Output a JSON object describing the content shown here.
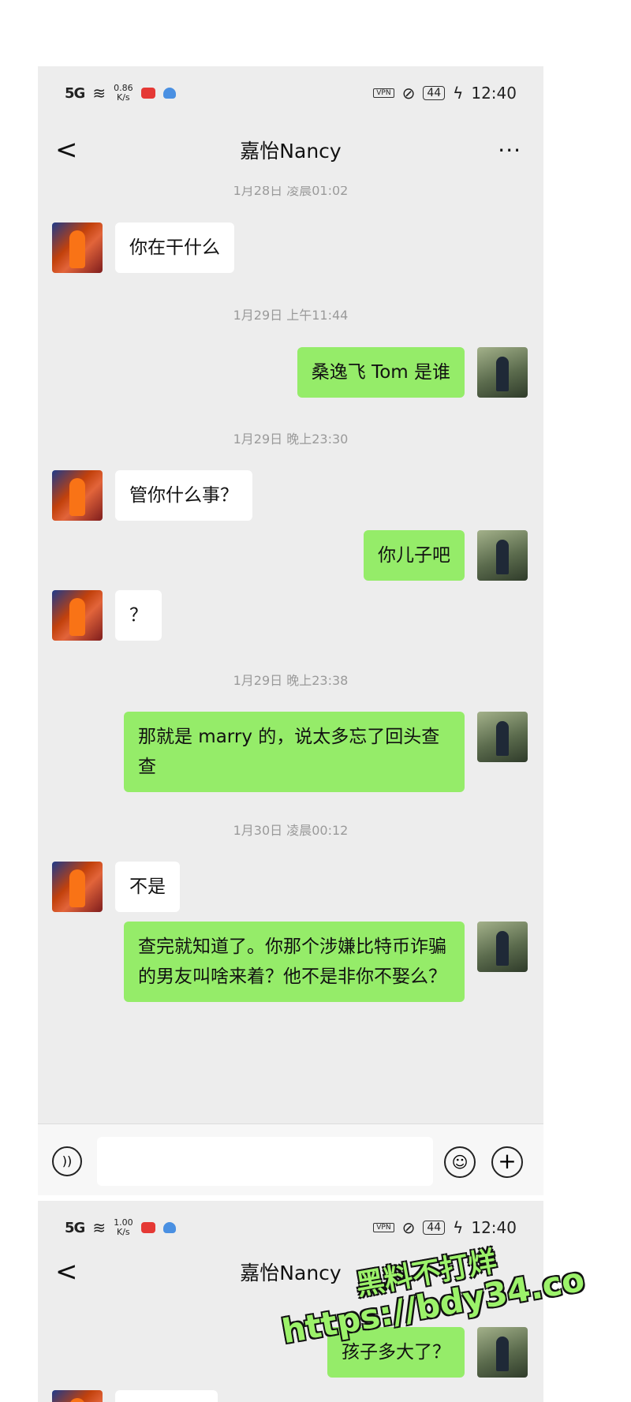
{
  "status1": {
    "signal": "5G",
    "speed_value": "0.86",
    "speed_unit": "K/s",
    "vpn": "VPN",
    "battery": "44",
    "time": "12:40"
  },
  "status2": {
    "signal": "5G",
    "speed_value": "1.00",
    "speed_unit": "K/s",
    "vpn": "VPN",
    "battery": "44",
    "time": "12:40"
  },
  "header": {
    "title": "嘉怡Nancy",
    "back": "<",
    "more": "···"
  },
  "messages": {
    "ts0": "1月28日 凌晨01:02",
    "m1": "你在干什么",
    "ts1": "1月29日 上午11:44",
    "m2": "桑逸飞 Tom 是谁",
    "ts2": "1月29日 晚上23:30",
    "m3": "管你什么事？",
    "m4": "你儿子吧",
    "m5": "？",
    "ts3": "1月29日 晚上23:38",
    "m6": "那就是 marry 的，说太多忘了回头查查",
    "ts4": "1月30日 凌晨00:12",
    "m7": "不是",
    "m8": "查完就知道了。你那个涉嫌比特币诈骗的男友叫啥来着？他不是非你不娶么？"
  },
  "second": {
    "partial_message": "孩子多大了？"
  },
  "watermark": {
    "line1": "黑料不打烊",
    "line2": "https://bdy34.co"
  },
  "colors": {
    "bg": "#ededed",
    "outgoing": "#95ec69",
    "incoming": "#ffffff",
    "timestamp": "#9a9a9a"
  },
  "icons": {
    "voice": "voice-icon",
    "emoji": "emoji-icon",
    "plus": "plus-icon"
  }
}
